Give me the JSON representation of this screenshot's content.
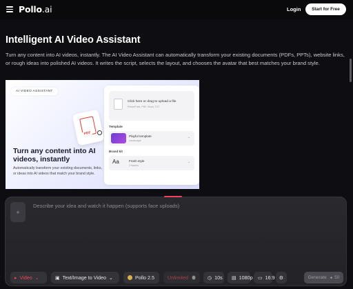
{
  "header": {
    "logo_main": "Pollo",
    "logo_suffix": ".ai",
    "login_label": "Login",
    "start_label": "Start for Free"
  },
  "main": {
    "title": "Intelligent AI Video Assistant",
    "description": "Turn any content into AI videos, instantly. The AI Video Assistant can automatically transform your existing documents (PDFs, PPTs), website links, or rough ideas into polished AI videos. It writes the script, selects the layout, and chooses the avatar that best matches your brand style."
  },
  "hero": {
    "tag": "AI VIDEO ASSISTANT",
    "pdf_label": "PDF",
    "headline": "Turn any content into AI videos, instantly",
    "subtext": "Automatically transform your existing documents, links, or ideas into AI videos that match your brand style.",
    "upload_title": "Click here or drag to upload a file",
    "upload_formats": "PowerPoint, PDF, Word, TXT",
    "template_heading": "Template",
    "template_name": "Playful template",
    "template_sub": "Landscape",
    "brandkit_heading": "Brand kit",
    "brand_name": "Fresh style",
    "brand_sub": "2 frames",
    "brand_glyph": "Aa"
  },
  "composer": {
    "add_glyph": "+",
    "placeholder": "Describe your idea and watch it happen (supports face uploads)",
    "video_label": "Video",
    "mode_label": "Text/Image to Video",
    "model_label": "Pollo 2.5",
    "unlimited_label": "Unlimited",
    "duration_label": "10s",
    "resolution_label": "1080p",
    "aspect_label": "16:9",
    "generate_label": "Generate",
    "generate_cost": "50"
  },
  "colors": {
    "accent": "#f3445a",
    "background": "#0e0e12",
    "composer": "#2a2a2e"
  }
}
